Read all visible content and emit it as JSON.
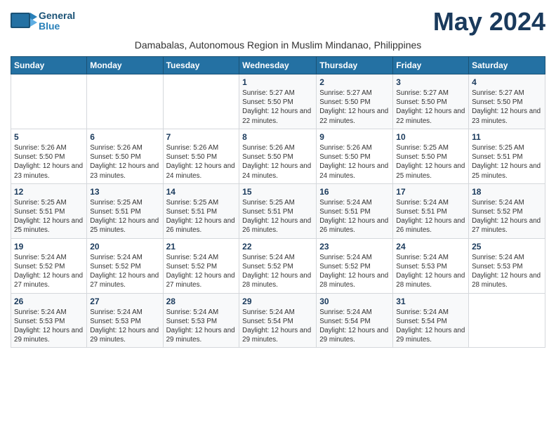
{
  "header": {
    "logo_line1": "General",
    "logo_line2": "Blue",
    "month_title": "May 2024",
    "subtitle": "Damabalas, Autonomous Region in Muslim Mindanao, Philippines"
  },
  "days_of_week": [
    "Sunday",
    "Monday",
    "Tuesday",
    "Wednesday",
    "Thursday",
    "Friday",
    "Saturday"
  ],
  "weeks": [
    [
      {
        "day": "",
        "info": ""
      },
      {
        "day": "",
        "info": ""
      },
      {
        "day": "",
        "info": ""
      },
      {
        "day": "1",
        "info": "Sunrise: 5:27 AM\nSunset: 5:50 PM\nDaylight: 12 hours and 22 minutes."
      },
      {
        "day": "2",
        "info": "Sunrise: 5:27 AM\nSunset: 5:50 PM\nDaylight: 12 hours and 22 minutes."
      },
      {
        "day": "3",
        "info": "Sunrise: 5:27 AM\nSunset: 5:50 PM\nDaylight: 12 hours and 22 minutes."
      },
      {
        "day": "4",
        "info": "Sunrise: 5:27 AM\nSunset: 5:50 PM\nDaylight: 12 hours and 23 minutes."
      }
    ],
    [
      {
        "day": "5",
        "info": "Sunrise: 5:26 AM\nSunset: 5:50 PM\nDaylight: 12 hours and 23 minutes."
      },
      {
        "day": "6",
        "info": "Sunrise: 5:26 AM\nSunset: 5:50 PM\nDaylight: 12 hours and 23 minutes."
      },
      {
        "day": "7",
        "info": "Sunrise: 5:26 AM\nSunset: 5:50 PM\nDaylight: 12 hours and 24 minutes."
      },
      {
        "day": "8",
        "info": "Sunrise: 5:26 AM\nSunset: 5:50 PM\nDaylight: 12 hours and 24 minutes."
      },
      {
        "day": "9",
        "info": "Sunrise: 5:26 AM\nSunset: 5:50 PM\nDaylight: 12 hours and 24 minutes."
      },
      {
        "day": "10",
        "info": "Sunrise: 5:25 AM\nSunset: 5:50 PM\nDaylight: 12 hours and 25 minutes."
      },
      {
        "day": "11",
        "info": "Sunrise: 5:25 AM\nSunset: 5:51 PM\nDaylight: 12 hours and 25 minutes."
      }
    ],
    [
      {
        "day": "12",
        "info": "Sunrise: 5:25 AM\nSunset: 5:51 PM\nDaylight: 12 hours and 25 minutes."
      },
      {
        "day": "13",
        "info": "Sunrise: 5:25 AM\nSunset: 5:51 PM\nDaylight: 12 hours and 25 minutes."
      },
      {
        "day": "14",
        "info": "Sunrise: 5:25 AM\nSunset: 5:51 PM\nDaylight: 12 hours and 26 minutes."
      },
      {
        "day": "15",
        "info": "Sunrise: 5:25 AM\nSunset: 5:51 PM\nDaylight: 12 hours and 26 minutes."
      },
      {
        "day": "16",
        "info": "Sunrise: 5:24 AM\nSunset: 5:51 PM\nDaylight: 12 hours and 26 minutes."
      },
      {
        "day": "17",
        "info": "Sunrise: 5:24 AM\nSunset: 5:51 PM\nDaylight: 12 hours and 26 minutes."
      },
      {
        "day": "18",
        "info": "Sunrise: 5:24 AM\nSunset: 5:52 PM\nDaylight: 12 hours and 27 minutes."
      }
    ],
    [
      {
        "day": "19",
        "info": "Sunrise: 5:24 AM\nSunset: 5:52 PM\nDaylight: 12 hours and 27 minutes."
      },
      {
        "day": "20",
        "info": "Sunrise: 5:24 AM\nSunset: 5:52 PM\nDaylight: 12 hours and 27 minutes."
      },
      {
        "day": "21",
        "info": "Sunrise: 5:24 AM\nSunset: 5:52 PM\nDaylight: 12 hours and 27 minutes."
      },
      {
        "day": "22",
        "info": "Sunrise: 5:24 AM\nSunset: 5:52 PM\nDaylight: 12 hours and 28 minutes."
      },
      {
        "day": "23",
        "info": "Sunrise: 5:24 AM\nSunset: 5:52 PM\nDaylight: 12 hours and 28 minutes."
      },
      {
        "day": "24",
        "info": "Sunrise: 5:24 AM\nSunset: 5:53 PM\nDaylight: 12 hours and 28 minutes."
      },
      {
        "day": "25",
        "info": "Sunrise: 5:24 AM\nSunset: 5:53 PM\nDaylight: 12 hours and 28 minutes."
      }
    ],
    [
      {
        "day": "26",
        "info": "Sunrise: 5:24 AM\nSunset: 5:53 PM\nDaylight: 12 hours and 29 minutes."
      },
      {
        "day": "27",
        "info": "Sunrise: 5:24 AM\nSunset: 5:53 PM\nDaylight: 12 hours and 29 minutes."
      },
      {
        "day": "28",
        "info": "Sunrise: 5:24 AM\nSunset: 5:53 PM\nDaylight: 12 hours and 29 minutes."
      },
      {
        "day": "29",
        "info": "Sunrise: 5:24 AM\nSunset: 5:54 PM\nDaylight: 12 hours and 29 minutes."
      },
      {
        "day": "30",
        "info": "Sunrise: 5:24 AM\nSunset: 5:54 PM\nDaylight: 12 hours and 29 minutes."
      },
      {
        "day": "31",
        "info": "Sunrise: 5:24 AM\nSunset: 5:54 PM\nDaylight: 12 hours and 29 minutes."
      },
      {
        "day": "",
        "info": ""
      }
    ]
  ]
}
